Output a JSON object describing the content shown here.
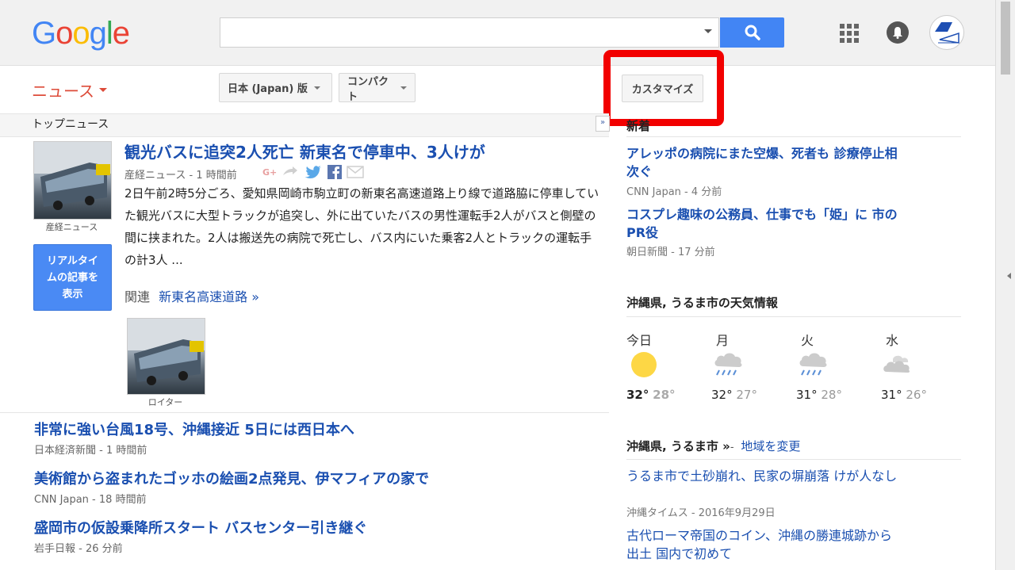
{
  "header": {
    "logo_letters": [
      "G",
      "o",
      "o",
      "g",
      "l",
      "e"
    ],
    "search_value": ""
  },
  "toolbar": {
    "news_label": "ニュース",
    "edition_label": "日本 (Japan) 版",
    "view_label": "コンパクト",
    "customize_label": "カスタマイズ"
  },
  "top_news": {
    "section_label": "トップニュース",
    "collapse_label": "»",
    "featured": {
      "headline": "観光バスに追突2人死亡 新東名で停車中、3人けが",
      "source": "産経ニュース",
      "time": "1 時間前",
      "thumb_caption": "産経ニュース",
      "snippet": "2日午前2時5分ごろ、愛知県岡崎市駒立町の新東名高速道路上り線で道路脇に停車していた観光バスに大型トラックが追突し、外に出ていたバスの男性運転手2人がバスと側壁の間に挟まれた。2人は搬送先の病院で死亡し、バス内にいた乗客2人とトラックの運転手の計3人 ...",
      "related_label": "関連",
      "related_link": "新東名高速道路 »",
      "realtime_button": "リアルタイムの記事を表示",
      "image2_caption": "ロイター",
      "share_gplus": "G+"
    },
    "stories": [
      {
        "headline": "非常に強い台風18号、沖縄接近 5日には西日本へ",
        "source": "日本経済新聞",
        "time": "1 時間前"
      },
      {
        "headline": "美術館から盗まれたゴッホの絵画2点発見、伊マフィアの家で",
        "source": "CNN Japan",
        "time": "18 時間前"
      },
      {
        "headline": "盛岡市の仮設乗降所スタート バスセンター引き継ぐ",
        "source": "岩手日報",
        "time": "26 分前"
      }
    ]
  },
  "sidebar": {
    "latest_label": "新着",
    "latest": [
      {
        "headline": "アレッポの病院にまた空爆、死者も 診療停止相次ぐ",
        "source": "CNN Japan",
        "time": "4 分前"
      },
      {
        "headline": "コスプレ趣味の公務員、仕事でも「姫」に 市のPR役",
        "source": "朝日新聞",
        "time": "17 分前"
      }
    ],
    "weather": {
      "title": "沖縄県, うるま市の天気情報",
      "days": [
        {
          "label": "今日",
          "icon": "sun-icon",
          "high": "32°",
          "low": "28°"
        },
        {
          "label": "月",
          "icon": "rain-icon",
          "high": "32°",
          "low": "27°"
        },
        {
          "label": "火",
          "icon": "rain-icon",
          "high": "31°",
          "low": "28°"
        },
        {
          "label": "水",
          "icon": "cloud-icon",
          "high": "31°",
          "low": "26°"
        }
      ]
    },
    "local": {
      "title": "沖縄県, うるま市 »",
      "dash": "-",
      "change_label": "地域を変更",
      "items": [
        {
          "headline": "うるま市で土砂崩れ、民家の塀崩落 けが人なし",
          "source": "沖縄タイムス",
          "time": "2016年9月29日"
        },
        {
          "headline": "古代ローマ帝国のコイン、沖縄の勝連城跡から出土 国内で初めて",
          "source": "",
          "time": ""
        }
      ]
    }
  },
  "colors": {
    "link": "#1a4fb0",
    "accent_red": "#dd4b39",
    "highlight": "#f20000",
    "search_blue": "#4285f4"
  }
}
